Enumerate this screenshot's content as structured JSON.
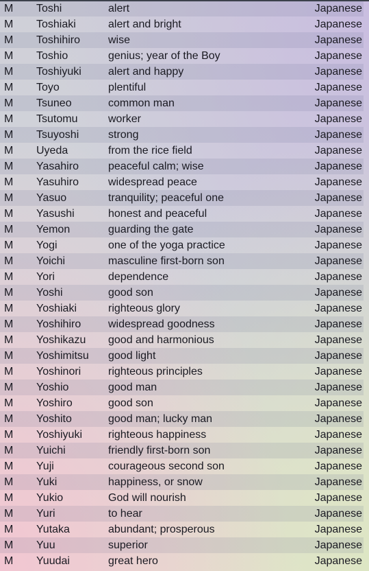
{
  "rows": [
    {
      "gender": "M",
      "name": "Toshi",
      "meaning": "alert",
      "origin": "Japanese"
    },
    {
      "gender": "M",
      "name": "Toshiaki",
      "meaning": "alert and bright",
      "origin": "Japanese"
    },
    {
      "gender": "M",
      "name": "Toshihiro",
      "meaning": "wise",
      "origin": "Japanese"
    },
    {
      "gender": "M",
      "name": "Toshio",
      "meaning": "genius; year of the Boy",
      "origin": "Japanese"
    },
    {
      "gender": "M",
      "name": "Toshiyuki",
      "meaning": "alert and happy",
      "origin": "Japanese"
    },
    {
      "gender": "M",
      "name": "Toyo",
      "meaning": "plentiful",
      "origin": "Japanese"
    },
    {
      "gender": "M",
      "name": "Tsuneo",
      "meaning": "common man",
      "origin": "Japanese"
    },
    {
      "gender": "M",
      "name": "Tsutomu",
      "meaning": "worker",
      "origin": "Japanese"
    },
    {
      "gender": "M",
      "name": "Tsuyoshi",
      "meaning": "strong",
      "origin": "Japanese"
    },
    {
      "gender": "M",
      "name": "Uyeda",
      "meaning": "from the rice field",
      "origin": "Japanese"
    },
    {
      "gender": "M",
      "name": "Yasahiro",
      "meaning": "peaceful calm; wise",
      "origin": "Japanese"
    },
    {
      "gender": "M",
      "name": "Yasuhiro",
      "meaning": "widespread peace",
      "origin": "Japanese"
    },
    {
      "gender": "M",
      "name": "Yasuo",
      "meaning": "tranquility; peaceful one",
      "origin": "Japanese"
    },
    {
      "gender": "M",
      "name": "Yasushi",
      "meaning": "honest and peaceful",
      "origin": "Japanese"
    },
    {
      "gender": "M",
      "name": "Yemon",
      "meaning": "guarding the gate",
      "origin": "Japanese"
    },
    {
      "gender": "M",
      "name": "Yogi",
      "meaning": "one of the yoga practice",
      "origin": "Japanese"
    },
    {
      "gender": "M",
      "name": "Yoichi",
      "meaning": "masculine first-born son",
      "origin": "Japanese"
    },
    {
      "gender": "M",
      "name": "Yori",
      "meaning": "dependence",
      "origin": "Japanese"
    },
    {
      "gender": "M",
      "name": "Yoshi",
      "meaning": "good son",
      "origin": "Japanese"
    },
    {
      "gender": "M",
      "name": "Yoshiaki",
      "meaning": "righteous glory",
      "origin": "Japanese"
    },
    {
      "gender": "M",
      "name": "Yoshihiro",
      "meaning": "widespread goodness",
      "origin": "Japanese"
    },
    {
      "gender": "M",
      "name": "Yoshikazu",
      "meaning": "good and harmonious",
      "origin": "Japanese"
    },
    {
      "gender": "M",
      "name": "Yoshimitsu",
      "meaning": "good light",
      "origin": "Japanese"
    },
    {
      "gender": "M",
      "name": "Yoshinori",
      "meaning": "righteous principles",
      "origin": "Japanese"
    },
    {
      "gender": "M",
      "name": "Yoshio",
      "meaning": "good man",
      "origin": "Japanese"
    },
    {
      "gender": "M",
      "name": "Yoshiro",
      "meaning": "good son",
      "origin": "Japanese"
    },
    {
      "gender": "M",
      "name": "Yoshito",
      "meaning": "good man; lucky man",
      "origin": "Japanese"
    },
    {
      "gender": "M",
      "name": "Yoshiyuki",
      "meaning": "righteous happiness",
      "origin": "Japanese"
    },
    {
      "gender": "M",
      "name": "Yuichi",
      "meaning": "friendly first-born son",
      "origin": "Japanese"
    },
    {
      "gender": "M",
      "name": "Yuji",
      "meaning": "courageous second son",
      "origin": "Japanese"
    },
    {
      "gender": "M",
      "name": "Yuki",
      "meaning": "happiness, or snow",
      "origin": "Japanese"
    },
    {
      "gender": "M",
      "name": "Yukio",
      "meaning": "God will nourish",
      "origin": "Japanese"
    },
    {
      "gender": "M",
      "name": "Yuri",
      "meaning": "to hear",
      "origin": "Japanese"
    },
    {
      "gender": "M",
      "name": "Yutaka",
      "meaning": "abundant; prosperous",
      "origin": "Japanese"
    },
    {
      "gender": "M",
      "name": "Yuu",
      "meaning": "superior",
      "origin": "Japanese"
    },
    {
      "gender": "M",
      "name": "Yuudai",
      "meaning": "great hero",
      "origin": "Japanese"
    }
  ]
}
